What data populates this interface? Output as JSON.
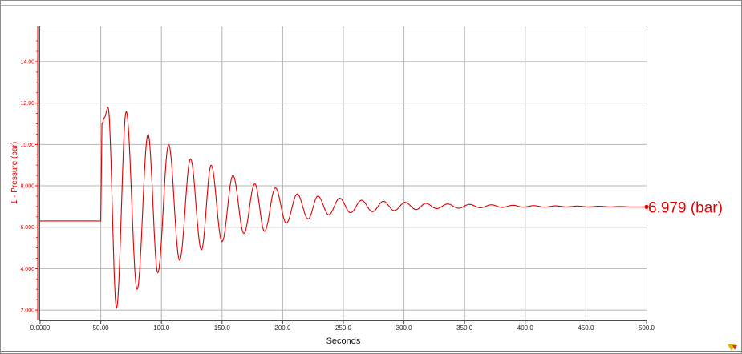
{
  "chart_data": {
    "type": "line",
    "xlabel": "Seconds",
    "ylabel": "1 - Pressure (bar)",
    "xlim": [
      0,
      500
    ],
    "ylim": [
      1.5,
      15.7
    ],
    "x_ticks": [
      0,
      50,
      100,
      150,
      200,
      250,
      300,
      350,
      400,
      450,
      500
    ],
    "x_tick_labels": [
      "0.0000",
      "50.00",
      "100.0",
      "150.0",
      "200.0",
      "250.0",
      "300.0",
      "350.0",
      "400.0",
      "450.0",
      "500.0"
    ],
    "y_ticks": [
      2,
      4,
      6,
      8,
      10,
      12,
      14
    ],
    "y_tick_labels": [
      "2.000",
      "4.000",
      "6.000",
      "8.000",
      "10.00",
      "12.00",
      "14.00"
    ],
    "grid": true,
    "line_color": "#e00000",
    "series": [
      {
        "x": [
          0,
          49,
          50,
          51,
          53,
          56,
          63,
          71,
          80,
          89,
          97,
          106,
          115,
          124,
          133,
          141,
          150,
          159,
          168,
          177,
          185,
          194,
          203,
          212,
          221,
          229,
          238,
          247,
          256,
          265,
          274,
          283,
          292,
          301,
          310,
          318,
          327,
          336,
          345,
          354,
          363,
          372,
          381,
          390,
          398,
          407,
          416,
          425,
          434,
          443,
          452,
          461,
          470,
          478,
          487,
          496,
          500
        ],
        "y": [
          6.3,
          6.3,
          6.3,
          11.0,
          11.3,
          11.8,
          2.1,
          11.6,
          3.0,
          10.5,
          3.8,
          10.0,
          4.4,
          9.3,
          4.9,
          9.0,
          5.3,
          8.5,
          5.7,
          8.1,
          5.8,
          7.9,
          6.2,
          7.6,
          6.4,
          7.5,
          6.6,
          7.4,
          6.7,
          7.3,
          6.75,
          7.25,
          6.8,
          7.2,
          6.85,
          7.15,
          6.9,
          7.12,
          6.92,
          7.1,
          6.94,
          7.08,
          6.96,
          7.06,
          6.97,
          7.04,
          6.97,
          7.03,
          6.98,
          7.02,
          6.98,
          7.01,
          6.98,
          7.0,
          6.98,
          6.98,
          6.979
        ]
      }
    ],
    "end_readout": "6.979 (bar)"
  }
}
